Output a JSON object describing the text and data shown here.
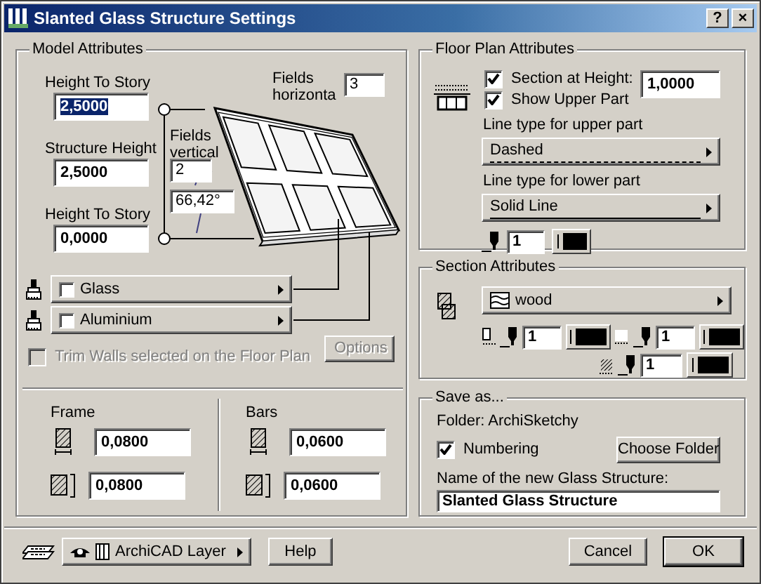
{
  "window": {
    "title": "Slanted Glass Structure Settings",
    "buttons": [
      "?",
      "×"
    ]
  },
  "model_attributes": {
    "title": "Model Attributes",
    "heights": [
      {
        "label": "Height To Story",
        "value": "2,5000",
        "selected": true
      },
      {
        "label": "Structure Height",
        "value": "2,5000",
        "selected": false
      },
      {
        "label": "Height To Story",
        "value": "0,0000",
        "selected": false
      }
    ],
    "fields_horizontal": {
      "label": "Fields horizonta",
      "value": "3"
    },
    "fields_vertical": {
      "label": "Fields vertical",
      "value": "2"
    },
    "angle": "66,42°",
    "materials": [
      {
        "name": "Glass",
        "checked": false
      },
      {
        "name": "Aluminium",
        "checked": false
      }
    ],
    "trim_walls": {
      "label": "Trim Walls selected on the Floor Plan",
      "checked": false,
      "disabled": true
    },
    "options_button": {
      "label": "Options",
      "disabled": true
    },
    "frame": {
      "title": "Frame",
      "values": [
        "0,0800",
        "0,0800"
      ]
    },
    "bars": {
      "title": "Bars",
      "values": [
        "0,0600",
        "0,0600"
      ]
    }
  },
  "floor_plan": {
    "title": "Floor Plan Attributes",
    "options": [
      {
        "label": "Section at Height:",
        "checked": true
      },
      {
        "label": "Show Upper Part",
        "checked": true
      }
    ],
    "height_value": "1,0000",
    "line_types": [
      {
        "label": "Line type for upper part",
        "value": "Dashed",
        "kind": "dashed"
      },
      {
        "label": "Line type for lower part",
        "value": "Solid Line",
        "kind": "solid"
      }
    ],
    "pen": "1"
  },
  "section_attributes": {
    "title": "Section Attributes",
    "fill": "wood",
    "pens": [
      "1",
      "1",
      "1"
    ]
  },
  "save_as": {
    "title": "Save as...",
    "folder": "Folder: ArchiSketchy",
    "numbering": {
      "label": "Numbering",
      "checked": true
    },
    "choose_button": "Choose Folder",
    "name_label": "Name of the new Glass Structure:",
    "name_value": "Slanted Glass Structure"
  },
  "footer": {
    "layer": "ArchiCAD Layer",
    "buttons": [
      {
        "label": "Help",
        "default": false
      },
      {
        "label": "Cancel",
        "default": false
      },
      {
        "label": "OK",
        "default": true
      }
    ]
  }
}
